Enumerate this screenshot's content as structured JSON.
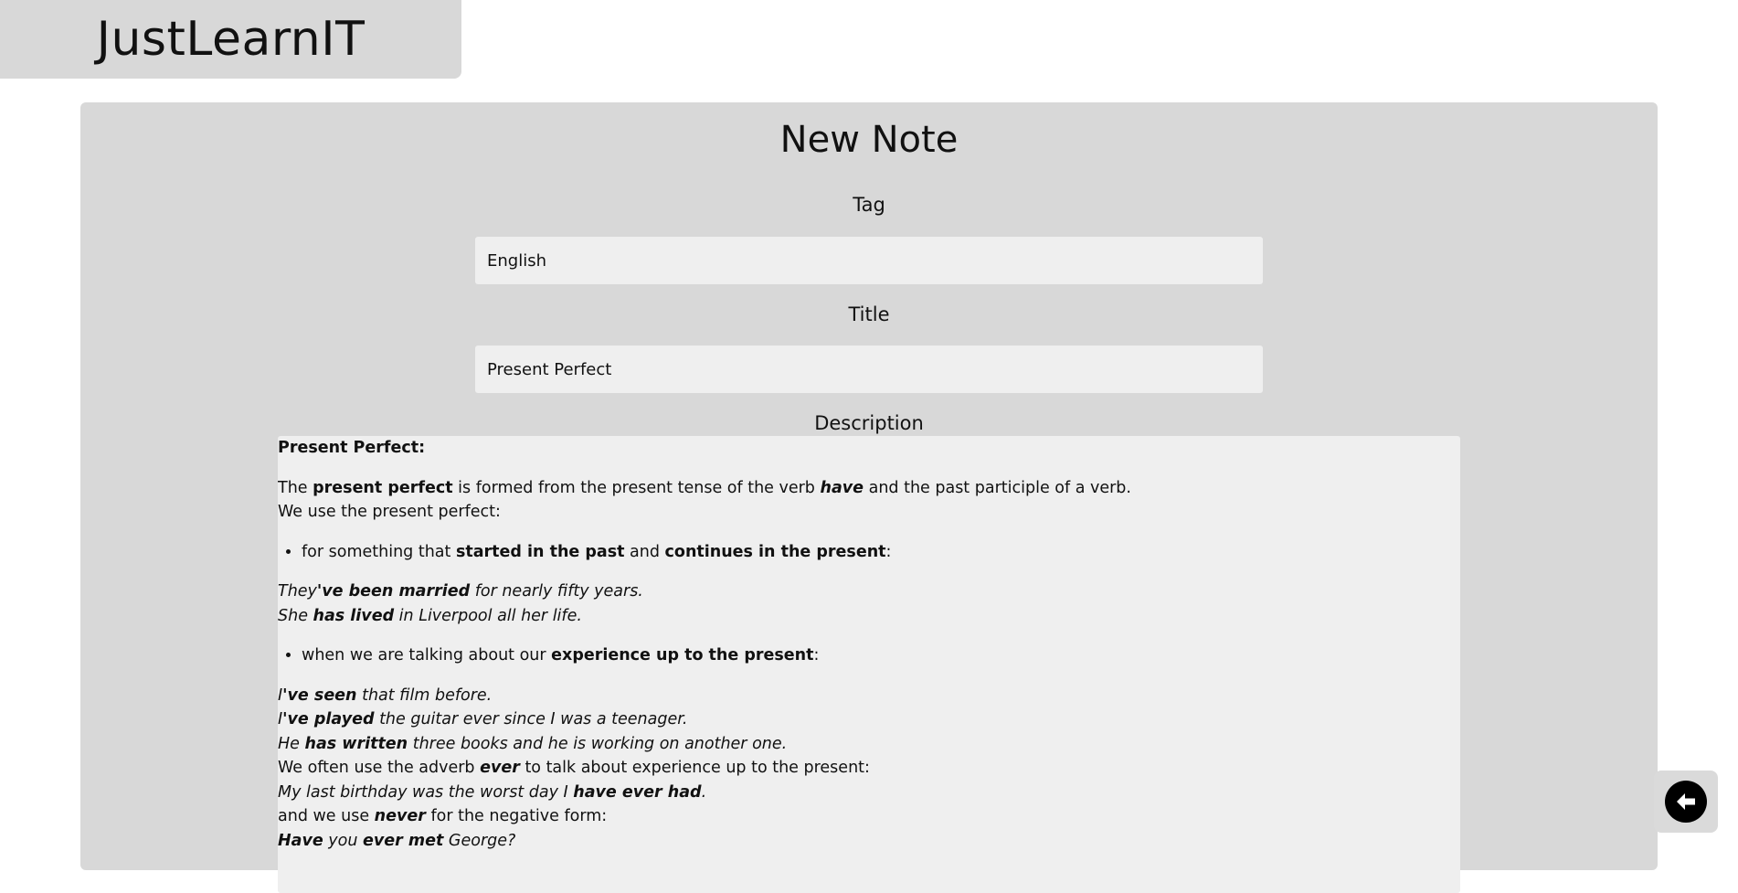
{
  "brand": {
    "name": "JustLearnIT"
  },
  "form": {
    "title": "New Note",
    "tag": {
      "label": "Tag",
      "value": "English"
    },
    "note_title": {
      "label": "Title",
      "value": "Present Perfect"
    },
    "description": {
      "label": "Description",
      "heading": "Present Perfect:",
      "intro": {
        "t1": "The ",
        "b1": "present perfect",
        "t2": " is formed from the present tense of the verb ",
        "bi1": "have",
        "t3": " and the past participle of a verb."
      },
      "use_line": "We use the present perfect:",
      "bullet1": {
        "t1": "for something that ",
        "b1": "started in the past",
        "t2": " and ",
        "b2": "continues in the present",
        "t3": ":"
      },
      "ex1": {
        "i1": "They",
        "bi1": "'ve been married",
        "i2": " for nearly fifty years."
      },
      "ex2": {
        "i1": "She ",
        "bi1": "has lived",
        "i2": " in Liverpool all her life."
      },
      "bullet2": {
        "t1": "when we are talking about our ",
        "b1": "experience up to the present",
        "t2": ":"
      },
      "ex3": {
        "i1": "I",
        "bi1": "'ve seen",
        "i2": " that film before."
      },
      "ex4": {
        "i1": "I",
        "bi1": "'ve played",
        "i2": " the guitar ever since I was a teenager."
      },
      "ex5": {
        "i1": "He ",
        "bi1": "has written",
        "i2": " three books and he is working on another one."
      },
      "ever_line": {
        "t1": "We often use the adverb ",
        "bi1": "ever",
        "t2": " to talk about experience up to the present:"
      },
      "ex6": {
        "i1": "My last birthday was the worst day I ",
        "bi1": "have ever had",
        "i2": "."
      },
      "never_line": {
        "t1": "and we use ",
        "bi1": "never",
        "t2": " for the negative form:"
      },
      "ex7": {
        "bi1": "Have",
        "i1": " you ",
        "bi2": "ever met",
        "i2": " George?"
      }
    }
  },
  "back_button": {
    "icon": "arrow-left-icon"
  }
}
